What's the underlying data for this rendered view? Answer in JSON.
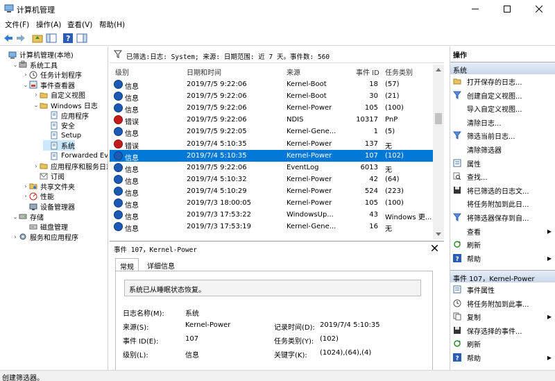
{
  "window": {
    "title": "计算机管理"
  },
  "menu": [
    "文件(F)",
    "操作(A)",
    "查看(V)",
    "帮助(H)"
  ],
  "tree": [
    {
      "label": "计算机管理(本地)",
      "indent": 0,
      "arrow": "",
      "icon": "computer-icon"
    },
    {
      "label": "系统工具",
      "indent": 1,
      "arrow": "v",
      "icon": "tools-icon"
    },
    {
      "label": "任务计划程序",
      "indent": 2,
      "arrow": ">",
      "icon": "clock-icon"
    },
    {
      "label": "事件查看器",
      "indent": 2,
      "arrow": "v",
      "icon": "event-viewer-icon"
    },
    {
      "label": "自定义视图",
      "indent": 3,
      "arrow": ">",
      "icon": "folder-icon"
    },
    {
      "label": "Windows 日志",
      "indent": 3,
      "arrow": "v",
      "icon": "folder-icon"
    },
    {
      "label": "应用程序",
      "indent": 4,
      "arrow": "",
      "icon": "log-icon"
    },
    {
      "label": "安全",
      "indent": 4,
      "arrow": "",
      "icon": "log-icon"
    },
    {
      "label": "Setup",
      "indent": 4,
      "arrow": "",
      "icon": "log-icon"
    },
    {
      "label": "系统",
      "indent": 4,
      "arrow": "",
      "icon": "log-icon",
      "selected": true
    },
    {
      "label": "Forwarded Event",
      "indent": 4,
      "arrow": "",
      "icon": "log-icon"
    },
    {
      "label": "应用程序和服务日志",
      "indent": 3,
      "arrow": ">",
      "icon": "folder-icon"
    },
    {
      "label": "订阅",
      "indent": 3,
      "arrow": "",
      "icon": "subscription-icon"
    },
    {
      "label": "共享文件夹",
      "indent": 2,
      "arrow": ">",
      "icon": "shared-folder-icon"
    },
    {
      "label": "性能",
      "indent": 2,
      "arrow": ">",
      "icon": "performance-icon"
    },
    {
      "label": "设备管理器",
      "indent": 2,
      "arrow": "",
      "icon": "device-manager-icon"
    },
    {
      "label": "存储",
      "indent": 1,
      "arrow": "v",
      "icon": "storage-icon"
    },
    {
      "label": "磁盘管理",
      "indent": 2,
      "arrow": "",
      "icon": "disk-icon"
    },
    {
      "label": "服务和应用程序",
      "indent": 1,
      "arrow": ">",
      "icon": "services-icon"
    }
  ],
  "filter": {
    "text": "已筛选:日志: System; 来源: 日期范围: 近 7 天。事件数: 560"
  },
  "grid": {
    "columns": [
      "级别",
      "日期和时间",
      "来源",
      "事件 ID",
      "任务类别"
    ],
    "rows": [
      {
        "level": "信息",
        "type": "info",
        "datetime": "2019/7/5 9:22:06",
        "source": "Kernel-Boot",
        "id": "18",
        "task": "(57)"
      },
      {
        "level": "信息",
        "type": "info",
        "datetime": "2019/7/5 9:22:06",
        "source": "Kernel-Boot",
        "id": "30",
        "task": "(21)"
      },
      {
        "level": "信息",
        "type": "info",
        "datetime": "2019/7/5 9:22:06",
        "source": "Kernel-Power",
        "id": "105",
        "task": "(100)"
      },
      {
        "level": "错误",
        "type": "error",
        "datetime": "2019/7/5 9:22:06",
        "source": "NDIS",
        "id": "10317",
        "task": "PnP"
      },
      {
        "level": "信息",
        "type": "info",
        "datetime": "2019/7/5 9:22:05",
        "source": "Kernel-Gene...",
        "id": "1",
        "task": "(5)"
      },
      {
        "level": "错误",
        "type": "error",
        "datetime": "2019/7/4 5:10:35",
        "source": "Kernel-Power",
        "id": "137",
        "task": "无"
      },
      {
        "level": "信息",
        "type": "info",
        "datetime": "2019/7/4 5:10:35",
        "source": "Kernel-Power",
        "id": "107",
        "task": "(102)",
        "selected": true
      },
      {
        "level": "信息",
        "type": "info",
        "datetime": "2019/7/5 9:22:06",
        "source": "EventLog",
        "id": "6013",
        "task": "无"
      },
      {
        "level": "信息",
        "type": "info",
        "datetime": "2019/7/4 5:10:32",
        "source": "Kernel-Power",
        "id": "42",
        "task": "(64)"
      },
      {
        "level": "信息",
        "type": "info",
        "datetime": "2019/7/4 5:10:29",
        "source": "Kernel-Power",
        "id": "524",
        "task": "(223)"
      },
      {
        "level": "信息",
        "type": "info",
        "datetime": "2019/7/3 18:00:05",
        "source": "Kernel-Power",
        "id": "105",
        "task": "(100)"
      },
      {
        "level": "信息",
        "type": "info",
        "datetime": "2019/7/3 17:53:22",
        "source": "WindowsUp...",
        "id": "43",
        "task": "Windows 更..."
      },
      {
        "level": "信息",
        "type": "info",
        "datetime": "2019/7/3 17:53:19",
        "source": "Kernel-Gene...",
        "id": "16",
        "task": "无"
      }
    ]
  },
  "detail": {
    "title": "事件 107，Kernel-Power",
    "tabs": [
      "常规",
      "详细信息"
    ],
    "message": "系统已从睡眠状态恢复。",
    "fields": {
      "log_name_label": "日志名称(M):",
      "log_name": "系统",
      "source_label": "来源(S):",
      "source": "Kernel-Power",
      "logged_label": "记录时间(D):",
      "logged": "2019/7/4 5:10:35",
      "event_id_label": "事件 ID(E):",
      "event_id": "107",
      "task_label": "任务类别(Y):",
      "task": "(102)",
      "level_label": "级别(L):",
      "level": "信息",
      "keywords_label": "关键字(K):",
      "keywords": "(1024),(64),(4)"
    }
  },
  "actions": {
    "header": "操作",
    "section1": "系统",
    "items1": [
      {
        "label": "打开保存的日志...",
        "icon": "open-folder-icon"
      },
      {
        "label": "创建自定义视图...",
        "icon": "filter-icon"
      },
      {
        "label": "导入自定义视图...",
        "icon": ""
      },
      {
        "label": "清除日志...",
        "icon": ""
      },
      {
        "label": "筛选当前日志...",
        "icon": "filter-icon"
      },
      {
        "label": "清除筛选器",
        "icon": ""
      },
      {
        "label": "属性",
        "icon": "properties-icon"
      },
      {
        "label": "查找...",
        "icon": "find-icon"
      },
      {
        "label": "将已筛选的日志文...",
        "icon": "save-icon"
      },
      {
        "label": "将任务附加到此日...",
        "icon": ""
      },
      {
        "label": "将筛选器保存到自...",
        "icon": "filter-icon"
      },
      {
        "label": "查看",
        "icon": "",
        "sub": "▶"
      },
      {
        "label": "刷新",
        "icon": "refresh-icon"
      },
      {
        "label": "帮助",
        "icon": "help-icon",
        "sub": "▶"
      }
    ],
    "section2": "事件 107，Kernel-Power",
    "items2": [
      {
        "label": "事件属性",
        "icon": "properties-icon"
      },
      {
        "label": "将任务附加到此事...",
        "icon": "task-icon"
      },
      {
        "label": "复制",
        "icon": "copy-icon",
        "sub": "▶"
      },
      {
        "label": "保存选择的事件...",
        "icon": "save-icon"
      },
      {
        "label": "刷新",
        "icon": "refresh-icon"
      },
      {
        "label": "帮助",
        "icon": "help-icon",
        "sub": "▶"
      }
    ]
  },
  "status": {
    "text": "创建筛选器。"
  }
}
